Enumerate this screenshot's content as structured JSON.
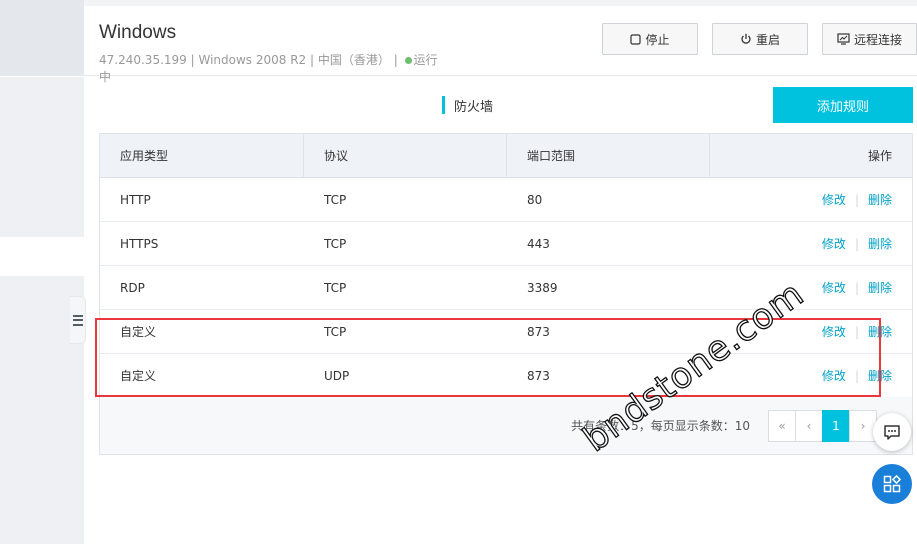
{
  "instance": {
    "title": "Windows",
    "ip": "47.240.35.199",
    "os": "Windows 2008 R2",
    "region": "中国（香港）",
    "status": "运行中",
    "status_color": "#6cc06c"
  },
  "actions": {
    "stop": "停止",
    "restart": "重启",
    "remote": "远程连接"
  },
  "firewall": {
    "section_title": "防火墙",
    "add_rule": "添加规则",
    "columns": [
      "应用类型",
      "协议",
      "端口范围",
      "操作"
    ],
    "rows": [
      {
        "app": "HTTP",
        "protocol": "TCP",
        "port": "80"
      },
      {
        "app": "HTTPS",
        "protocol": "TCP",
        "port": "443"
      },
      {
        "app": "RDP",
        "protocol": "TCP",
        "port": "3389"
      },
      {
        "app": "自定义",
        "protocol": "TCP",
        "port": "873"
      },
      {
        "app": "自定义",
        "protocol": "UDP",
        "port": "873"
      }
    ],
    "edit": "修改",
    "delete": "删除"
  },
  "pagination": {
    "summary": "共有条数：5，每页显示条数：10",
    "first": "«",
    "prev": "‹",
    "current": "1",
    "next": "›"
  },
  "icons": {
    "stop": "stop-square-icon",
    "restart": "power-icon",
    "remote": "remote-desktop-icon",
    "chat": "chat-icon",
    "apps": "apps-icon",
    "collapse": "menu-collapse-icon"
  },
  "colors": {
    "accent": "#00c1de",
    "link": "#00a2ca",
    "highlight": "#e8383d",
    "fab": "#1a7fd9"
  },
  "watermark": "bndstone.com"
}
